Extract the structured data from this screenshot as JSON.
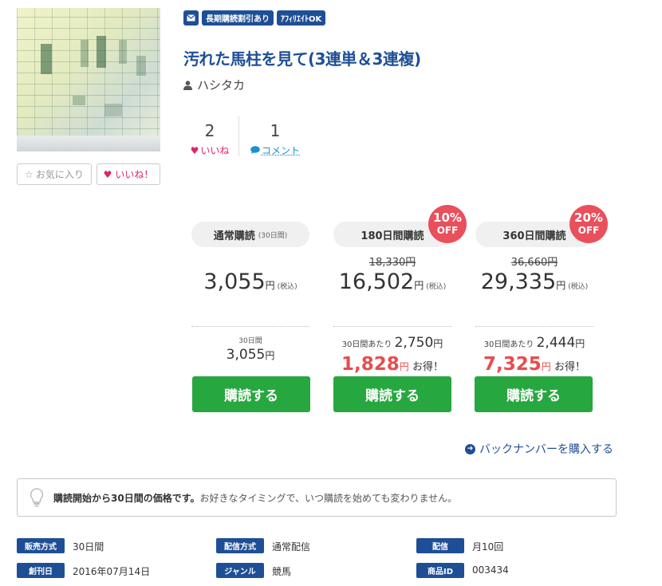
{
  "product": {
    "tags": [
      "長期購読割引あり",
      "ｱﾌｨﾘｴｲﾄOK"
    ],
    "title": "汚れた馬柱を見て(3連単＆3連複)",
    "author": "ハシタカ",
    "likes_count": "2",
    "likes_label": "いいね",
    "comments_count": "1",
    "comments_label": "コメント",
    "favorite_button": "お気に入り",
    "like_button": "いいね！"
  },
  "plans": [
    {
      "name": "通常購読",
      "period_note": "(30日間)",
      "price": "3,055",
      "yen": "円",
      "tax": "(税込)",
      "sub_label": "30日間",
      "sub_price": "3,055",
      "buy": "購読する"
    },
    {
      "name": "180日間購読",
      "discount_pct": "10%",
      "discount_off": "OFF",
      "original_price": "18,330円",
      "price": "16,502",
      "yen": "円",
      "tax": "(税込)",
      "per_label": "30日間あたり",
      "per_price": "2,750",
      "saving": "1,828",
      "saving_suffix": "お得！",
      "buy": "購読する"
    },
    {
      "name": "360日間購読",
      "discount_pct": "20%",
      "discount_off": "OFF",
      "original_price": "36,660円",
      "price": "29,335",
      "yen": "円",
      "tax": "(税込)",
      "per_label": "30日間あたり",
      "per_price": "2,444",
      "saving": "7,325",
      "saving_suffix": "お得！",
      "buy": "購読する"
    }
  ],
  "back_number_link": "バックナンバーを購入する",
  "notice": {
    "bold": "購読開始から30日間の価格です。",
    "text": "お好きなタイミングで、いつ購読を始めても変わりません。"
  },
  "meta": {
    "sales_method_label": "販売方式",
    "sales_method": "30日間",
    "delivery_method_label": "配信方式",
    "delivery_method": "通常配信",
    "delivery_label": "配信",
    "delivery": "月10回",
    "first_issue_label": "創刊日",
    "first_issue": "2016年07月14日",
    "genre_label": "ジャンル",
    "genre": "競馬",
    "product_id_label": "商品ID",
    "product_id": "003434"
  },
  "colors": {
    "brand": "#1e4f96",
    "buy": "#27a73f",
    "sale": "#e84c4c",
    "like": "#e0245e"
  }
}
